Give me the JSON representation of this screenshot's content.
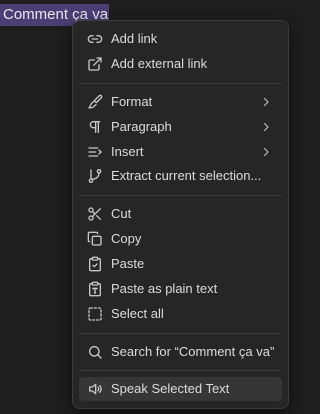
{
  "selection": {
    "text": "Comment ça va"
  },
  "menu": {
    "items": [
      {
        "label": "Add link",
        "icon": "link-icon"
      },
      {
        "label": "Add external link",
        "icon": "external-link-icon"
      },
      {
        "label": "Format",
        "icon": "paintbrush-icon",
        "submenu": true
      },
      {
        "label": "Paragraph",
        "icon": "pilcrow-icon",
        "submenu": true
      },
      {
        "label": "Insert",
        "icon": "insert-icon",
        "submenu": true
      },
      {
        "label": "Extract current selection...",
        "icon": "git-branch-icon"
      },
      {
        "label": "Cut",
        "icon": "scissors-icon"
      },
      {
        "label": "Copy",
        "icon": "copy-icon"
      },
      {
        "label": "Paste",
        "icon": "clipboard-check-icon"
      },
      {
        "label": "Paste as plain text",
        "icon": "clipboard-type-icon"
      },
      {
        "label": "Select all",
        "icon": "dashed-square-icon"
      },
      {
        "label": "Search for “Comment ça va”",
        "icon": "search-icon"
      },
      {
        "label": "Speak Selected Text",
        "icon": "speaker-icon",
        "highlighted": true
      }
    ]
  },
  "colors": {
    "background": "#1e1e1e",
    "selection_highlight": "#4a3f75",
    "menu_background": "#262626",
    "menu_hover": "#363636",
    "text": "#dcdcdc",
    "icon": "#c8c8c8"
  }
}
